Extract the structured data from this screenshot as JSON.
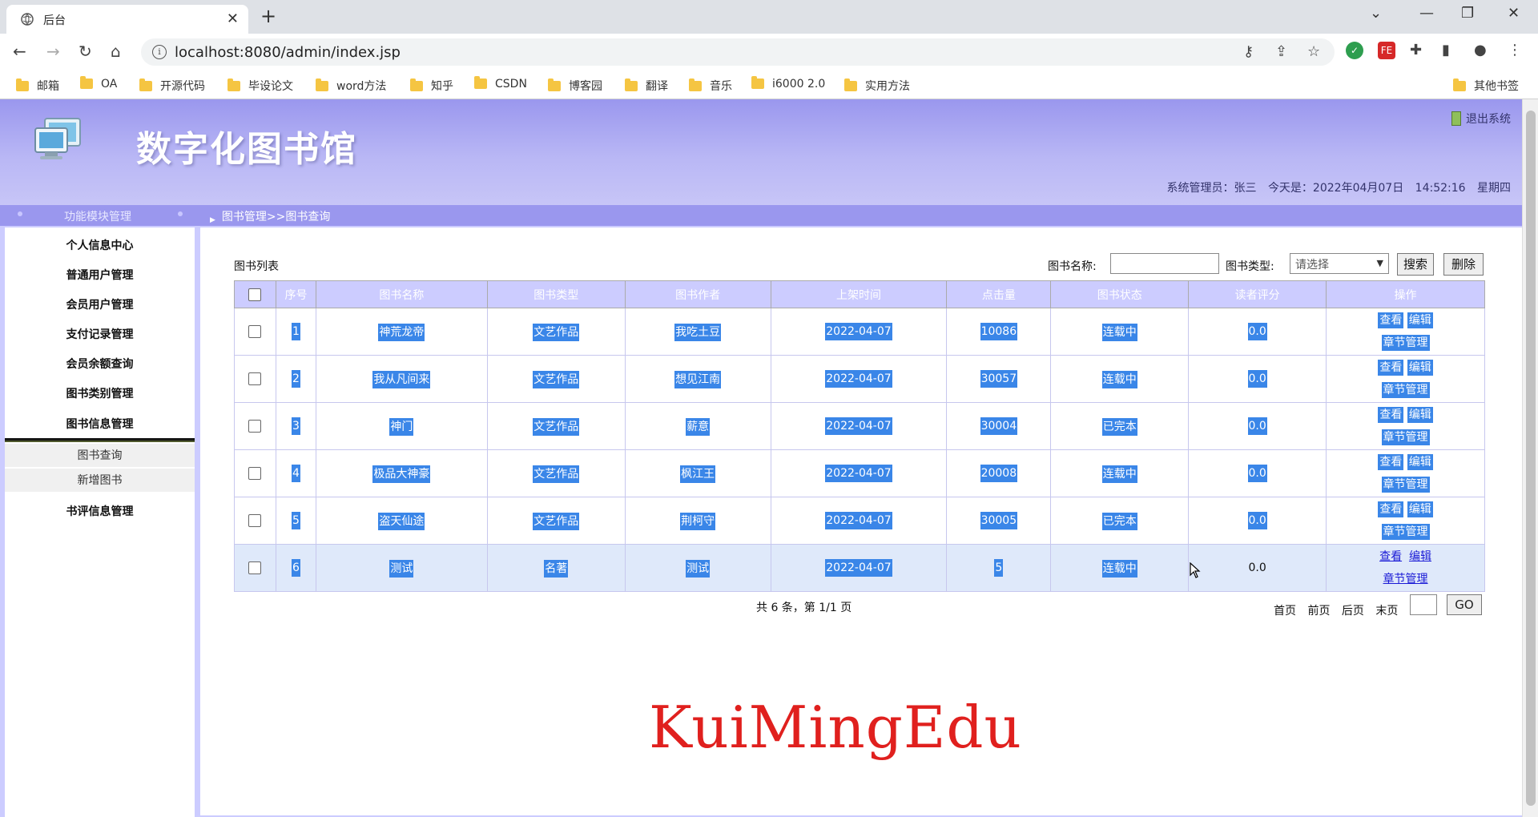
{
  "browser": {
    "tab_title": "后台",
    "url": "localhost:8080/admin/index.jsp",
    "bookmarks": [
      "邮箱",
      "OA",
      "开源代码",
      "毕设论文",
      "word方法",
      "知乎",
      "CSDN",
      "博客园",
      "翻译",
      "音乐",
      "i6000 2.0",
      "实用方法"
    ],
    "other_bookmarks": "其他书签",
    "extensions": [
      {
        "label": "✓",
        "color": "#2e9e4f"
      },
      {
        "label": "FE",
        "color": "#d62828"
      }
    ]
  },
  "header": {
    "site_title": "数字化图书馆",
    "logout": "退出系统",
    "admin_label": "系统管理员：张三",
    "date_label": "今天是：2022年04月07日",
    "time": "14:52:16",
    "weekday": "星期四"
  },
  "subbar": {
    "module_title": "功能模块管理",
    "breadcrumb": "图书管理>>图书查询"
  },
  "sidebar": {
    "items": [
      "个人信息中心",
      "普通用户管理",
      "会员用户管理",
      "支付记录管理",
      "会员余额查询",
      "图书类别管理",
      "图书信息管理"
    ],
    "submenu": [
      "图书查询",
      "新增图书"
    ],
    "after": "书评信息管理"
  },
  "main": {
    "list_title": "图书列表",
    "search_name_label": "图书名称:",
    "search_name_value": "",
    "search_type_label": "图书类型:",
    "search_type_selected": "请选择",
    "search_button": "搜索",
    "delete_button": "删除",
    "columns": [
      "序号",
      "图书名称",
      "图书类型",
      "图书作者",
      "上架时间",
      "点击量",
      "图书状态",
      "读者评分",
      "操作"
    ],
    "ops": {
      "view": "查看",
      "edit": "编辑",
      "chapters": "章节管理"
    },
    "rows": [
      {
        "id": "1",
        "name": "神荒龙帝",
        "type": "文艺作品",
        "author": "我吃土豆",
        "date": "2022-04-07",
        "clicks": "10086",
        "status": "连载中",
        "score": "0.0"
      },
      {
        "id": "2",
        "name": "我从凡间来",
        "type": "文艺作品",
        "author": "想见江南",
        "date": "2022-04-07",
        "clicks": "30057",
        "status": "连载中",
        "score": "0.0"
      },
      {
        "id": "3",
        "name": "神门",
        "type": "文艺作品",
        "author": "薪意",
        "date": "2022-04-07",
        "clicks": "30004",
        "status": "已完本",
        "score": "0.0"
      },
      {
        "id": "4",
        "name": "极品大神豪",
        "type": "文艺作品",
        "author": "枫江王",
        "date": "2022-04-07",
        "clicks": "20008",
        "status": "连载中",
        "score": "0.0"
      },
      {
        "id": "5",
        "name": "盗天仙途",
        "type": "文艺作品",
        "author": "荆柯守",
        "date": "2022-04-07",
        "clicks": "30005",
        "status": "已完本",
        "score": "0.0"
      },
      {
        "id": "6",
        "name": "测试",
        "type": "名著",
        "author": "测试",
        "date": "2022-04-07",
        "clicks": "5",
        "status": "连载中",
        "score": "0.0"
      }
    ],
    "pager_info": "共 6 条，第 1/1 页",
    "pager_links": [
      "首页",
      "前页",
      "后页",
      "末页"
    ],
    "go_button": "GO"
  },
  "watermark": "KuiMingEdu",
  "colors": {
    "header_purple": "#9a97ee",
    "selection_blue": "#3a86e8",
    "watermark_red": "#e0201e"
  }
}
